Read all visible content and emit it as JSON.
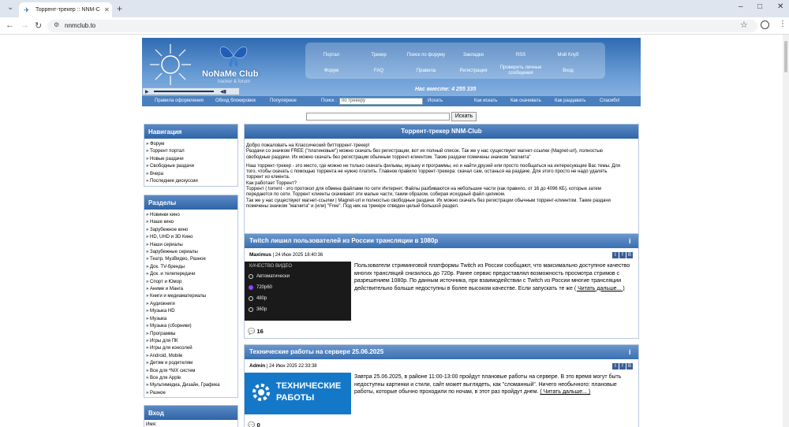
{
  "browser": {
    "tab_title": "Торрент-трекер :: NNM-Club",
    "url": "nnmclub.to"
  },
  "header": {
    "brand": "NoNaMe Club",
    "tagline": "tracker & forum",
    "menu_row1": [
      "Портал",
      "Трекер",
      "Поиск по форуму",
      "Закладки",
      "RSS",
      "Мой Клуб"
    ],
    "menu_row2": [
      "Форум",
      "FAQ",
      "Правила",
      "Регистрация",
      "Проверить личные сообщения",
      "Вход"
    ],
    "online": "Нас вместе: 4 255 335"
  },
  "subnav": {
    "items_left": [
      "Правила оформления",
      "Обход блокировок",
      "Популярное"
    ],
    "search_label": "Поиск :",
    "search_placeholder": "по трекеру",
    "search_button": "Искать",
    "items_right": [
      "Как искать",
      "Как скачивать",
      "Как раздавать",
      "Спасибо!"
    ]
  },
  "main_search": {
    "button": "Искать"
  },
  "navigation": {
    "title": "Навигация",
    "items": [
      "» Форум",
      "» Торрент портал",
      "» Новые раздачи",
      "» Свободные раздачи",
      "» Вчера",
      "» Последние дискуссии"
    ]
  },
  "sections": {
    "title": "Разделы",
    "items": [
      "» Новинки кино",
      "» Наше кино",
      "» Зарубежное кино",
      "» HD, UHD и 3D Кино",
      "» Наши сериалы",
      "» Зарубежные сериалы",
      "» Театр, МузВидео, Разное",
      "» Док. TV-бренды",
      "» Док. и телепередачи",
      "» Спорт и Юмор",
      "» Аниме и Манга",
      "» Книги и медиаматериалы",
      "» Аудиокниги",
      "» Музыка HD",
      "» Музыка",
      "» Музыка (сборники)",
      "» Программы",
      "» Игры для ПК",
      "» Игры для консолей",
      "» Android, Mobile",
      "» Детям и родителям",
      "» Все для *NIX систем",
      "» Все для Apple",
      "» Мультимедиа, Дизайн, Графика",
      "» Разное"
    ]
  },
  "login": {
    "title": "Вход",
    "name_label": "Имя:"
  },
  "intro": {
    "title": "Торрент-трекер NNM-Club",
    "lines": [
      "Добро пожаловать на Классический битторрент-трекер!",
      "Раздачи со значком FREE (\"платиновые\") можно скачать без регистрации, вот их полный список. Так же у нас существуют магнет-ссылки (Magnet-url), полностью",
      "свободные раздачи. Их можно скачать без регистрации обычным торрент-клиентом. Такие раздачи помечены значком \"магнита\"",
      "",
      "Наш торрент-трекер - это место, где можно не только скачать фильмы, музыку и программы, но и найти друзей или просто пообщаться на интересующие Вас темы. Для",
      "того, чтобы скачать с помощью торрента не нужно платить. Главное правило торрент-трекера: скачал сам, останься на раздаче. Для этого просто не надо удалять",
      "торрент из клиента.",
      "Как работает Торрент?",
      "Торрент ( torrent - это протокол для обмена файлами по сети Интернет. Файлы разбиваются на небольшие части (как правило, от 16 до 4096 КБ), которые затем",
      "передаются по сети. Торрент клиенты скачивают эти малые части, таким образом, собирая исходный файл целиком.",
      "Так же у нас существуют магнет-ссылки | Magnet-url и полностью свободные раздачи. Их можно скачать без регистрации обычным торрент-клиентом. Такие раздачи",
      "помечены значком \"магнита\" и (или) \"Free\". Под ник на трекере отведен целый большой раздел."
    ]
  },
  "news": [
    {
      "title": "Twitch лишил пользователей из России трансляции в 1080p",
      "author": "Maximus",
      "date": "| 24 Июн 2025 18:40:36",
      "image_title": "КАЧЕСТВО ВИДЕО",
      "image_options": [
        "Автоматически",
        "720p60",
        "480p",
        "360p"
      ],
      "text": "Пользователи стриминговой платформы Twitch из России сообщают, что максимально доступное качество многих трансляций снизилось до 720p. Ранее сервис предоставлял возможность просмотра стримов с разрешением 1080p. По данным источника, при взаимодействии с Twitch из России многие трансляции действительно больше недоступны в более высоком качестве. Если запускать те же",
      "more": "( Читать дальше... )",
      "comments": "16"
    },
    {
      "title": "Технические работы на сервере 25.06.2025",
      "author": "Admin",
      "date": "| 24 Июн 2025 22:33:38",
      "image_text": "ТЕХНИЧЕСКИЕ РАБОТЫ",
      "text": "Завтра 25.06.2025, в районе 11:00-13:00 пройдут плановые работы на сервере. В это время могут быть недоступны картинки и стили, сайт может выглядеть, как \"сломанный\". Ничего необычного: плановые работы, которые обычно проходили по ночам, в этот раз пройдут днем.",
      "more": "( Читать дальше... )",
      "comments": "0"
    }
  ]
}
